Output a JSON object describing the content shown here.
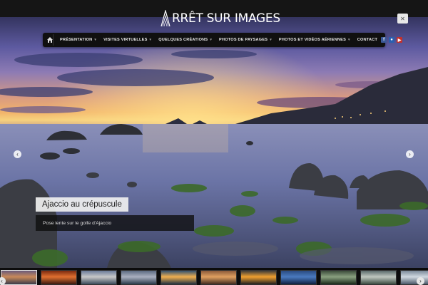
{
  "site": {
    "logo_text": "RRÊT SUR IMAGES"
  },
  "nav": {
    "items": [
      {
        "label": "PRÉSENTATION",
        "has_menu": true
      },
      {
        "label": "VISITES VIRTUELLES",
        "has_menu": true
      },
      {
        "label": "QUELQUES CRÉATIONS",
        "has_menu": true
      },
      {
        "label": "PHOTOS DE PAYSAGES",
        "has_menu": true
      },
      {
        "label": "PHOTOS ET VIDÉOS AÉRIENNES",
        "has_menu": true
      },
      {
        "label": "CONTACT",
        "has_menu": false
      }
    ],
    "social": [
      {
        "icon": "facebook-icon",
        "glyph": "f",
        "color": "#3b5998"
      },
      {
        "icon": "flickr-icon",
        "glyph": "●",
        "color": "#2a5fb0"
      },
      {
        "icon": "youtube-icon",
        "glyph": "▶",
        "color": "#c4302b"
      }
    ]
  },
  "slide": {
    "title": "Ajaccio au crépuscule",
    "subtitle": "Pose lente sur le golfe d'Ajaccio"
  },
  "thumbnails": [
    {
      "colors": [
        "#6a5a7a",
        "#c98a5a",
        "#3a3a4a"
      ]
    },
    {
      "colors": [
        "#7a2a10",
        "#e07030",
        "#3a1a10"
      ]
    },
    {
      "colors": [
        "#6a7a98",
        "#c8c8c8",
        "#3a4a5a"
      ]
    },
    {
      "colors": [
        "#5a6a80",
        "#aab0c0",
        "#2a3a4a"
      ]
    },
    {
      "colors": [
        "#305070",
        "#f0b050",
        "#203040"
      ]
    },
    {
      "colors": [
        "#8a5a3a",
        "#e0a060",
        "#402a20"
      ]
    },
    {
      "colors": [
        "#3a3a3a",
        "#f0a030",
        "#202020"
      ]
    },
    {
      "colors": [
        "#2a4a80",
        "#4a7ac0",
        "#102040"
      ]
    },
    {
      "colors": [
        "#3a4a3a",
        "#8aa080",
        "#1a2a1a"
      ]
    },
    {
      "colors": [
        "#5a6a6a",
        "#c0c8c0",
        "#3a4a40"
      ]
    },
    {
      "colors": [
        "#7a8898",
        "#d0d8e0",
        "#4a5868"
      ]
    }
  ]
}
